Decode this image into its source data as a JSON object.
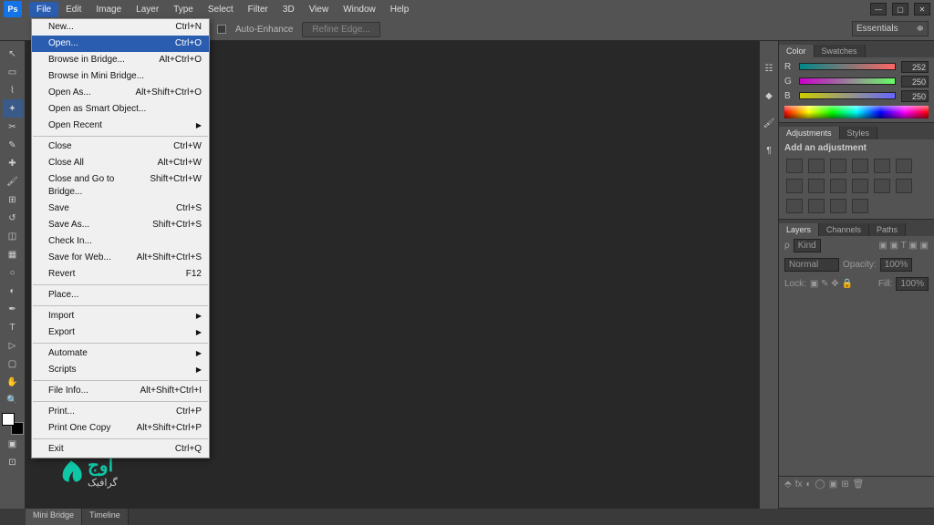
{
  "app": {
    "logo": "Ps"
  },
  "menubar": [
    "File",
    "Edit",
    "Image",
    "Layer",
    "Type",
    "Select",
    "Filter",
    "3D",
    "View",
    "Window",
    "Help"
  ],
  "options": {
    "auto_enhance": "Auto-Enhance",
    "refine_edge": "Refine Edge..."
  },
  "workspace": {
    "selected": "Essentials"
  },
  "file_menu": {
    "groups": [
      [
        {
          "label": "New...",
          "shortcut": "Ctrl+N"
        },
        {
          "label": "Open...",
          "shortcut": "Ctrl+O",
          "hl": true
        },
        {
          "label": "Browse in Bridge...",
          "shortcut": "Alt+Ctrl+O"
        },
        {
          "label": "Browse in Mini Bridge..."
        },
        {
          "label": "Open As...",
          "shortcut": "Alt+Shift+Ctrl+O"
        },
        {
          "label": "Open as Smart Object..."
        },
        {
          "label": "Open Recent",
          "sub": true
        }
      ],
      [
        {
          "label": "Close",
          "shortcut": "Ctrl+W"
        },
        {
          "label": "Close All",
          "shortcut": "Alt+Ctrl+W"
        },
        {
          "label": "Close and Go to Bridge...",
          "shortcut": "Shift+Ctrl+W"
        },
        {
          "label": "Save",
          "shortcut": "Ctrl+S"
        },
        {
          "label": "Save As...",
          "shortcut": "Shift+Ctrl+S"
        },
        {
          "label": "Check In..."
        },
        {
          "label": "Save for Web...",
          "shortcut": "Alt+Shift+Ctrl+S"
        },
        {
          "label": "Revert",
          "shortcut": "F12"
        }
      ],
      [
        {
          "label": "Place..."
        }
      ],
      [
        {
          "label": "Import",
          "sub": true
        },
        {
          "label": "Export",
          "sub": true
        }
      ],
      [
        {
          "label": "Automate",
          "sub": true
        },
        {
          "label": "Scripts",
          "sub": true
        }
      ],
      [
        {
          "label": "File Info...",
          "shortcut": "Alt+Shift+Ctrl+I"
        }
      ],
      [
        {
          "label": "Print...",
          "shortcut": "Ctrl+P"
        },
        {
          "label": "Print One Copy",
          "shortcut": "Alt+Shift+Ctrl+P"
        }
      ],
      [
        {
          "label": "Exit",
          "shortcut": "Ctrl+Q"
        }
      ]
    ]
  },
  "panels": {
    "color_tab": "Color",
    "swatches_tab": "Swatches",
    "adjustments_tab": "Adjustments",
    "styles_tab": "Styles",
    "layers_tab": "Layers",
    "channels_tab": "Channels",
    "paths_tab": "Paths",
    "color": {
      "r": 252,
      "g": 250,
      "b": 250
    },
    "adjustments_title": "Add an adjustment",
    "layers": {
      "kind": "Kind",
      "blend": "Normal",
      "opacity_label": "Opacity:",
      "opacity_val": "100%",
      "lock_label": "Lock:",
      "fill_label": "Fill:",
      "fill_val": "100%"
    }
  },
  "bottom_tabs": [
    "Mini Bridge",
    "Timeline"
  ],
  "watermark": {
    "text_ar": "اوج",
    "sub": "گرافیک"
  }
}
